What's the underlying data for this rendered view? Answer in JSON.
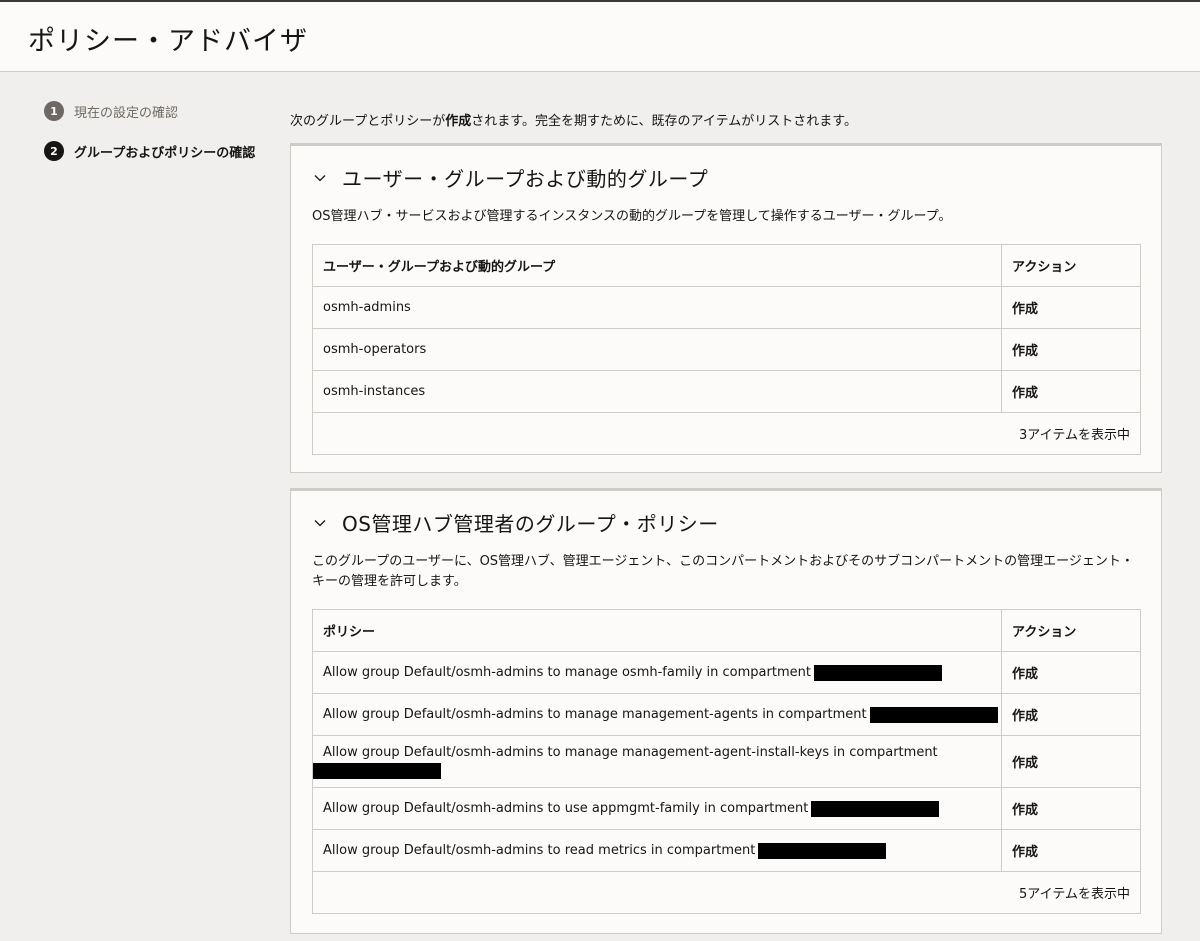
{
  "page_title": "ポリシー・アドバイザ",
  "steps": [
    {
      "number": "1",
      "label": "現在の設定の確認",
      "state": "done"
    },
    {
      "number": "2",
      "label": "グループおよびポリシーの確認",
      "state": "active"
    }
  ],
  "intro": {
    "before": "次のグループとポリシーが",
    "bold": "作成",
    "after": "されます。完全を期すために、既存のアイテムがリストされます。"
  },
  "groups_section": {
    "title": "ユーザー・グループおよび動的グループ",
    "description": "OS管理ハブ・サービスおよび管理するインスタンスの動的グループを管理して操作するユーザー・グループ。",
    "columns": [
      "ユーザー・グループおよび動的グループ",
      "アクション"
    ],
    "rows": [
      {
        "name": "osmh-admins",
        "action": "作成"
      },
      {
        "name": "osmh-operators",
        "action": "作成"
      },
      {
        "name": "osmh-instances",
        "action": "作成"
      }
    ],
    "footer": "3アイテムを表示中"
  },
  "policies_section": {
    "title": "OS管理ハブ管理者のグループ・ポリシー",
    "description": "このグループのユーザーに、OS管理ハブ、管理エージェント、このコンパートメントおよびそのサブコンパートメントの管理エージェント・キーの管理を許可します。",
    "columns": [
      "ポリシー",
      "アクション"
    ],
    "rows": [
      {
        "policy": "Allow group Default/osmh-admins to manage osmh-family in compartment",
        "action": "作成"
      },
      {
        "policy": "Allow group Default/osmh-admins to manage management-agents in compartment",
        "action": "作成"
      },
      {
        "policy": "Allow group Default/osmh-admins to manage management-agent-install-keys in compartment",
        "action": "作成"
      },
      {
        "policy": "Allow group Default/osmh-admins to use appmgmt-family in compartment",
        "action": "作成"
      },
      {
        "policy": "Allow group Default/osmh-admins to read metrics in compartment",
        "action": "作成"
      }
    ],
    "footer": "5アイテムを表示中"
  },
  "icons": {
    "collapse": "chevron-down-icon"
  },
  "colors": {
    "background": "#f1efed",
    "panel": "#fcfbfa",
    "border": "#cfcbc7",
    "text": "#161513",
    "muted": "#6f6964",
    "redaction": "#000000"
  }
}
